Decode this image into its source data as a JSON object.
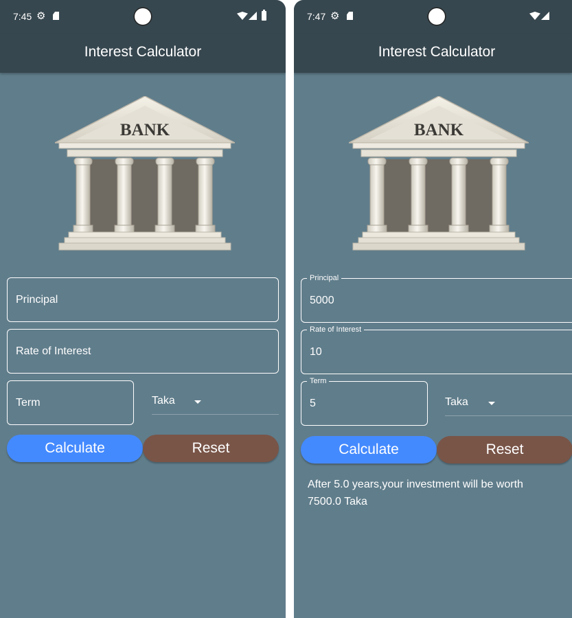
{
  "screens": [
    {
      "status": {
        "time": "7:45"
      },
      "app_title": "Interest Calculator",
      "image_text": "BANK",
      "form": {
        "principal": {
          "label": "Principal",
          "value": ""
        },
        "rate": {
          "label": "Rate of Interest",
          "value": ""
        },
        "term": {
          "label": "Term",
          "value": ""
        },
        "currency": {
          "selected": "Taka"
        }
      },
      "buttons": {
        "calculate": "Calculate",
        "reset": "Reset"
      },
      "result": ""
    },
    {
      "status": {
        "time": "7:47"
      },
      "app_title": "Interest Calculator",
      "image_text": "BANK",
      "form": {
        "principal": {
          "label": "Principal",
          "value": "5000"
        },
        "rate": {
          "label": "Rate of Interest",
          "value": "10"
        },
        "term": {
          "label": "Term",
          "value": "5"
        },
        "currency": {
          "selected": "Taka"
        }
      },
      "buttons": {
        "calculate": "Calculate",
        "reset": "Reset"
      },
      "result": "After 5.0 years,your investment will be worth 7500.0 Taka"
    }
  ],
  "colors": {
    "background": "#607d8b",
    "app_bar": "#37474f",
    "calculate_button": "#448aff",
    "reset_button": "#795548",
    "text": "#ffffff"
  },
  "icons": [
    "settings-gear-icon",
    "sim-card-icon",
    "wifi-icon",
    "signal-icon",
    "battery-icon",
    "dropdown-arrow-icon",
    "bank-building-icon"
  ]
}
